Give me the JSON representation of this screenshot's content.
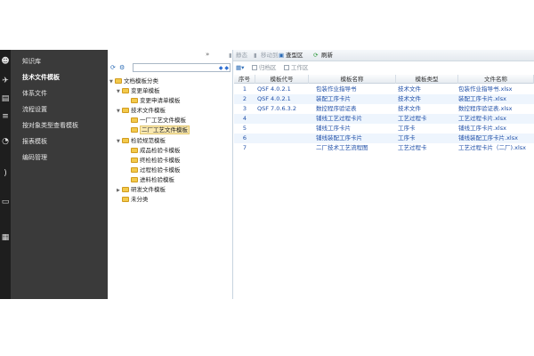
{
  "iconbar": {
    "icons": [
      "user-icon",
      "ribbon-icon",
      "book-icon",
      "layers-icon",
      "chart-icon",
      "wifi-icon",
      "window-icon",
      "list-icon"
    ]
  },
  "nav": {
    "items": [
      {
        "label": "知识库",
        "active": false
      },
      {
        "label": "技术文件模板",
        "active": true
      },
      {
        "label": "体系文件",
        "active": false
      },
      {
        "label": "流程设置",
        "active": false
      },
      {
        "label": "按对象类型查看模板",
        "active": false
      },
      {
        "label": "报表模板",
        "active": false
      },
      {
        "label": "编码管理",
        "active": false
      }
    ]
  },
  "toolbar": {
    "delete_label": "静态",
    "move_label": "移动到",
    "view_label": "查型区",
    "refresh_label": "刷新"
  },
  "subbar": {
    "archive_label": "归档区",
    "work_label": "工作区"
  },
  "tree": {
    "root": "文档模板分类",
    "nodes": [
      {
        "label": "变更单模板",
        "level": 1,
        "expanded": true
      },
      {
        "label": "变更申请单模板",
        "level": 2,
        "expanded": false
      },
      {
        "label": "技术文件模板",
        "level": 1,
        "expanded": true
      },
      {
        "label": "一厂工艺文件模板",
        "level": 2,
        "expanded": false
      },
      {
        "label": "二厂工艺文件模板",
        "level": 2,
        "expanded": false,
        "selected": true
      },
      {
        "label": "检验规范模板",
        "level": 1,
        "expanded": true
      },
      {
        "label": "成品检验卡模板",
        "level": 2,
        "expanded": false
      },
      {
        "label": "终检检验卡模板",
        "level": 2,
        "expanded": false
      },
      {
        "label": "过程检验卡模板",
        "level": 2,
        "expanded": false
      },
      {
        "label": "进料检验模板",
        "level": 2,
        "expanded": false
      },
      {
        "label": "研发文件模板",
        "level": 1,
        "expanded": false
      },
      {
        "label": "未分类",
        "level": 1,
        "expanded": false
      }
    ]
  },
  "grid": {
    "columns": [
      "序号",
      "模板代号",
      "模板名称",
      "模板类型",
      "文件名称"
    ],
    "rows": [
      [
        "1",
        "QSF 4.0.2.1",
        "包装作业指导书",
        "技术文件",
        "包装作业指导书.xlsx"
      ],
      [
        "2",
        "QSF 4.0.2.1",
        "装配工序卡片",
        "技术文件",
        "装配工序卡片.xlsx"
      ],
      [
        "3",
        "QSF 7.0.6.3.2",
        "数控程序验证表",
        "技术文件",
        "数控程序验证表.xlsx"
      ],
      [
        "4",
        "",
        "铺线工艺过程卡片",
        "工艺过程卡",
        "工艺过程卡片.xlsx"
      ],
      [
        "5",
        "",
        "铺线工序卡片",
        "工序卡",
        "铺线工序卡片.xlsx"
      ],
      [
        "6",
        "",
        "铺线装配工序卡片",
        "工序卡",
        "铺线装配工序卡片.xlsx"
      ],
      [
        "7",
        "",
        "二厂技术工艺流程图",
        "工艺过程卡",
        "工艺过程卡片（二厂).xlsx"
      ]
    ]
  }
}
